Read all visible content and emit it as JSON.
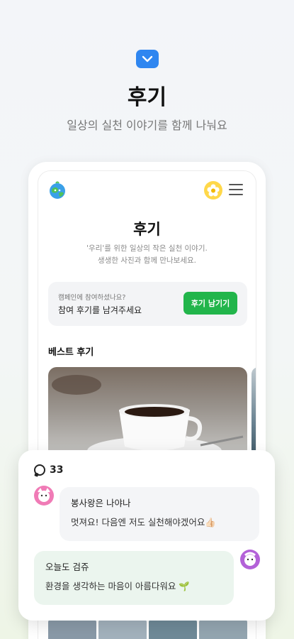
{
  "hero": {
    "title": "후기",
    "subtitle": "일상의 실천 이야기를 함께 나눠요",
    "icon": "chevron-down-icon",
    "accent": "#2f86f0"
  },
  "phone": {
    "header": {
      "logo_icon": "earth-character-icon",
      "avatar_icon": "flower-avatar-icon",
      "menu_icon": "menu-icon"
    },
    "page_title": "후기",
    "desc_line1": "'우리'를 위한 일상의 작은 실천 이야기.",
    "desc_line2": "생생한 사진과 함께 만나보세요.",
    "cta": {
      "small": "캠페인에 참여하셨나요?",
      "main": "참여 후기를 남겨주세요",
      "button": "후기 남기기",
      "button_color": "#22b54b"
    },
    "best_title": "베스트 후기"
  },
  "comments": {
    "count": "33",
    "items": [
      {
        "name": "봉사왕은 나야나",
        "text": "멋져요! 다음엔 저도 실천해야겠어요👍🏻",
        "avatar_color": "#f07bb6"
      },
      {
        "name": "오늘도 검쥬",
        "text": "환경을 생각하는 마음이 아름다워요 🌱",
        "avatar_color": "#b361d8"
      }
    ]
  }
}
